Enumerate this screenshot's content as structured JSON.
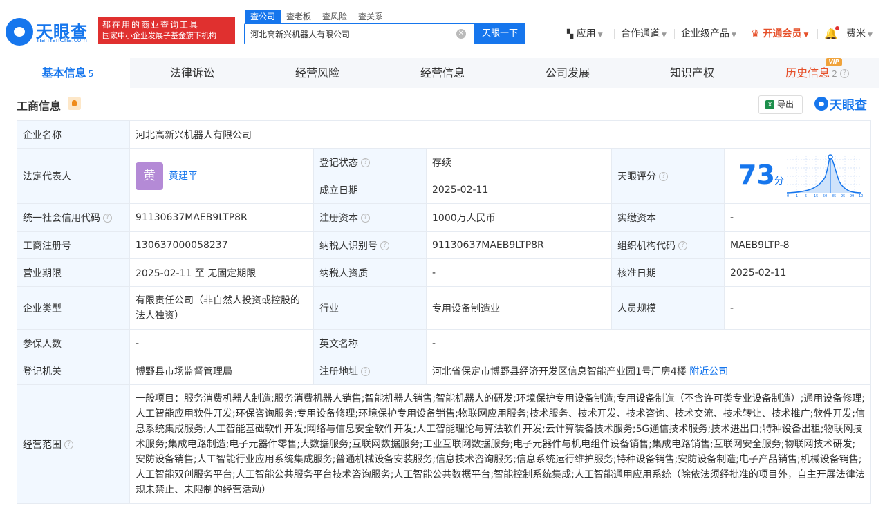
{
  "logo": {
    "name": "天眼查",
    "sub": "TianYanCha.com"
  },
  "banner": {
    "line1": "都在用的商业查询工具",
    "line2": "国家中小企业发展子基金旗下机构"
  },
  "search": {
    "tabs": [
      "查公司",
      "查老板",
      "查风险",
      "查关系"
    ],
    "value": "河北高新兴机器人有限公司",
    "button": "天眼一下"
  },
  "nav": {
    "apps": "应用",
    "channel": "合作通道",
    "enterprise": "企业级产品",
    "vip": "开通会员",
    "user": "费米"
  },
  "tabs": [
    {
      "label": "基本信息",
      "count": "5"
    },
    {
      "label": "法律诉讼"
    },
    {
      "label": "经营风险"
    },
    {
      "label": "经营信息"
    },
    {
      "label": "公司发展"
    },
    {
      "label": "知识产权"
    },
    {
      "label": "历史信息",
      "count": "2",
      "badge": "VIP"
    }
  ],
  "section": {
    "title": "工商信息",
    "export": "导出",
    "brand": "天眼查"
  },
  "info": {
    "company_name_label": "企业名称",
    "company_name": "河北高新兴机器人有限公司",
    "legal_rep_label": "法定代表人",
    "legal_rep_avatar": "黄",
    "legal_rep": "黄建平",
    "reg_status_label": "登记状态",
    "reg_status": "存续",
    "founded_label": "成立日期",
    "founded": "2025-02-11",
    "score_label": "天眼评分",
    "score": "73",
    "score_unit": "分",
    "score_axis": [
      "0",
      "1",
      "5",
      "15",
      "50",
      "85",
      "95",
      "99",
      "100"
    ],
    "credit_code_label": "统一社会信用代码",
    "credit_code": "91130637MAEB9LTP8R",
    "reg_capital_label": "注册资本",
    "reg_capital": "1000万人民币",
    "paid_capital_label": "实缴资本",
    "paid_capital": "-",
    "reg_no_label": "工商注册号",
    "reg_no": "130637000058237",
    "taxpayer_id_label": "纳税人识别号",
    "taxpayer_id": "91130637MAEB9LTP8R",
    "org_code_label": "组织机构代码",
    "org_code": "MAEB9LTP-8",
    "term_label": "营业期限",
    "term": "2025-02-11 至 无固定期限",
    "taxpayer_qual_label": "纳税人资质",
    "taxpayer_qual": "-",
    "approval_date_label": "核准日期",
    "approval_date": "2025-02-11",
    "type_label": "企业类型",
    "type": "有限责任公司（非自然人投资或控股的法人独资）",
    "industry_label": "行业",
    "industry": "专用设备制造业",
    "staff_label": "人员规模",
    "staff": "-",
    "insured_label": "参保人数",
    "insured": "-",
    "english_name_label": "英文名称",
    "english_name": "-",
    "authority_label": "登记机关",
    "authority": "博野县市场监督管理局",
    "address_label": "注册地址",
    "address": "河北省保定市博野县经济开发区信息智能产业园1号厂房4楼",
    "nearby": "附近公司",
    "scope_label": "经营范围",
    "scope": "一般项目：服务消费机器人制造;服务消费机器人销售;智能机器人销售;智能机器人的研发;环境保护专用设备制造;专用设备制造（不含许可类专业设备制造）;通用设备修理;人工智能应用软件开发;环保咨询服务;专用设备修理;环境保护专用设备销售;物联网应用服务;技术服务、技术开发、技术咨询、技术交流、技术转让、技术推广;软件开发;信息系统集成服务;人工智能基础软件开发;网络与信息安全软件开发;人工智能理论与算法软件开发;云计算装备技术服务;5G通信技术服务;技术进出口;特种设备出租;物联网技术服务;集成电路制造;电子元器件零售;大数据服务;互联网数据服务;工业互联网数据服务;电子元器件与机电组件设备销售;集成电路销售;互联网安全服务;物联网技术研发;安防设备销售;人工智能行业应用系统集成服务;普通机械设备安装服务;信息技术咨询服务;信息系统运行维护服务;特种设备销售;安防设备制造;电子产品销售;机械设备销售;人工智能双创服务平台;人工智能公共服务平台技术咨询服务;人工智能公共数据平台;智能控制系统集成;人工智能通用应用系统（除依法须经批准的项目外，自主开展法律法规未禁止、未限制的经营活动）"
  },
  "colors": {
    "brand": "#1676ed",
    "danger": "#e0302f",
    "vip": "#e6502a",
    "label_bg": "#f2f8ff"
  }
}
